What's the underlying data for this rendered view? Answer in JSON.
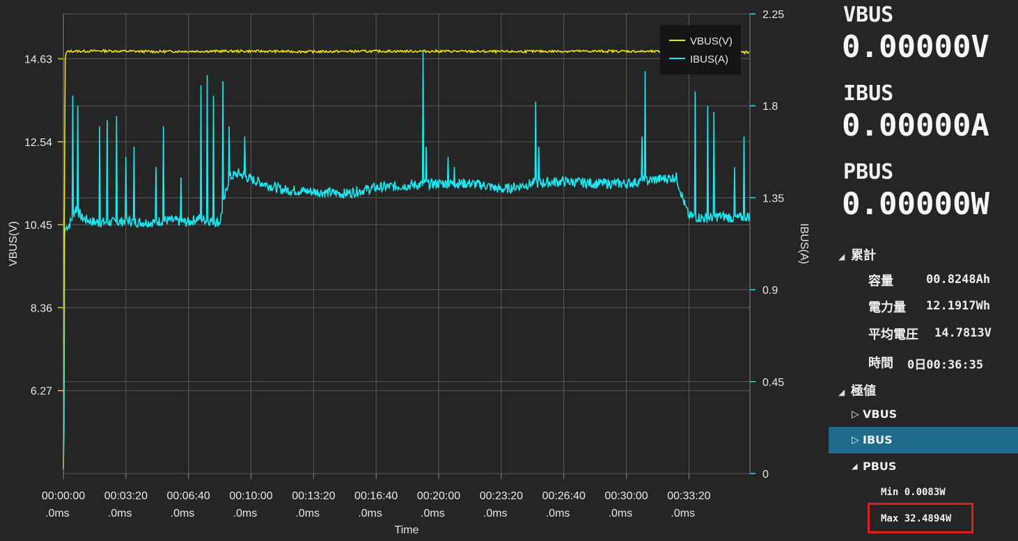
{
  "chart_data": {
    "type": "line",
    "xlabel": "Time",
    "ylabel_left": "VBUS(V)",
    "ylabel_right": "IBUS(A)",
    "x_ticks": [
      "00:00:00",
      "00:03:20",
      "00:06:40",
      "00:10:00",
      "00:13:20",
      "00:16:40",
      "00:20:00",
      "00:23:20",
      "00:26:40",
      "00:30:00",
      "00:33:20"
    ],
    "x_tick_sub": ".0ms",
    "x_range_seconds": [
      0,
      2195
    ],
    "left_ticks": [
      "6.27",
      "8.36",
      "10.45",
      "12.54",
      "14.63"
    ],
    "left_ylim": [
      4.18,
      15.76
    ],
    "right_ticks": [
      "0",
      "0.45",
      "0.9",
      "1.35",
      "1.8",
      "2.25"
    ],
    "right_ylim": [
      0,
      2.25
    ],
    "legend_position": "top-right",
    "grid": true,
    "series": [
      {
        "name": "VBUS(V)",
        "axis": "left",
        "color": "#f0e614",
        "x": [
          0,
          2,
          4,
          6,
          10,
          20,
          60,
          120,
          200,
          300,
          400,
          600,
          800,
          1000,
          1200,
          1400,
          1600,
          1800,
          2000,
          2195
        ],
        "y": [
          4.3,
          6.1,
          14.6,
          14.65,
          14.8,
          14.82,
          14.82,
          14.83,
          14.82,
          14.81,
          14.82,
          14.82,
          14.81,
          14.82,
          14.82,
          14.81,
          14.82,
          14.82,
          14.8,
          14.79
        ]
      },
      {
        "name": "IBUS(A)",
        "axis": "right",
        "color": "#19e8f0",
        "x": [
          0,
          2,
          3,
          6,
          20,
          40,
          60,
          80,
          100,
          140,
          180,
          200,
          240,
          280,
          330,
          400,
          430,
          460,
          500,
          520,
          530,
          560,
          600,
          700,
          800,
          900,
          1000,
          1100,
          1200,
          1300,
          1350,
          1400,
          1500,
          1600,
          1700,
          1800,
          1900,
          1960,
          1990,
          2000,
          2050,
          2100,
          2150,
          2195
        ],
        "y": [
          0.02,
          0.2,
          1.15,
          1.2,
          1.22,
          1.3,
          1.25,
          1.24,
          1.23,
          1.23,
          1.23,
          1.24,
          1.23,
          1.23,
          1.24,
          1.23,
          1.25,
          1.24,
          1.23,
          1.38,
          1.45,
          1.47,
          1.44,
          1.39,
          1.38,
          1.37,
          1.4,
          1.41,
          1.42,
          1.42,
          1.41,
          1.39,
          1.42,
          1.43,
          1.42,
          1.42,
          1.44,
          1.45,
          1.3,
          1.26,
          1.25,
          1.26,
          1.25,
          1.26
        ]
      }
    ],
    "spike_series": {
      "x": [
        30,
        45,
        115,
        140,
        170,
        200,
        225,
        295,
        320,
        375,
        440,
        460,
        480,
        510,
        530,
        580,
        1150,
        1160,
        1230,
        1250,
        1510,
        1520,
        1850,
        1860,
        2020,
        2060,
        2080,
        2145,
        2175
      ],
      "y": [
        1.85,
        1.8,
        1.7,
        1.73,
        1.75,
        1.55,
        1.6,
        1.5,
        1.7,
        1.45,
        1.9,
        1.95,
        1.85,
        1.92,
        1.7,
        1.65,
        2.07,
        1.6,
        1.55,
        1.5,
        1.82,
        1.6,
        1.65,
        1.97,
        1.87,
        1.8,
        1.77,
        1.5,
        1.65
      ]
    }
  },
  "panel": {
    "vbus_label": "VBUS",
    "vbus_value": "0.00000V",
    "ibus_label": "IBUS",
    "ibus_value": "0.00000A",
    "pbus_label": "PBUS",
    "pbus_value": "0.00000W",
    "cumulative": {
      "header": "累計",
      "items": [
        {
          "key": "容量",
          "value": "00.8248Ah"
        },
        {
          "key": "電力量",
          "value": "12.1917Wh"
        },
        {
          "key": "平均電圧",
          "value": "14.7813V"
        },
        {
          "key": "時間",
          "value": "0日00:36:35"
        }
      ]
    },
    "extremes": {
      "header": "極値",
      "items": [
        "VBUS",
        "IBUS",
        "PBUS"
      ],
      "selected": "IBUS",
      "pbus_min": "Min 0.0083W",
      "pbus_max": "Max 32.4894W"
    },
    "colors": {
      "selection": "#1f6b8e",
      "highlight_box": "#e0201c"
    }
  }
}
